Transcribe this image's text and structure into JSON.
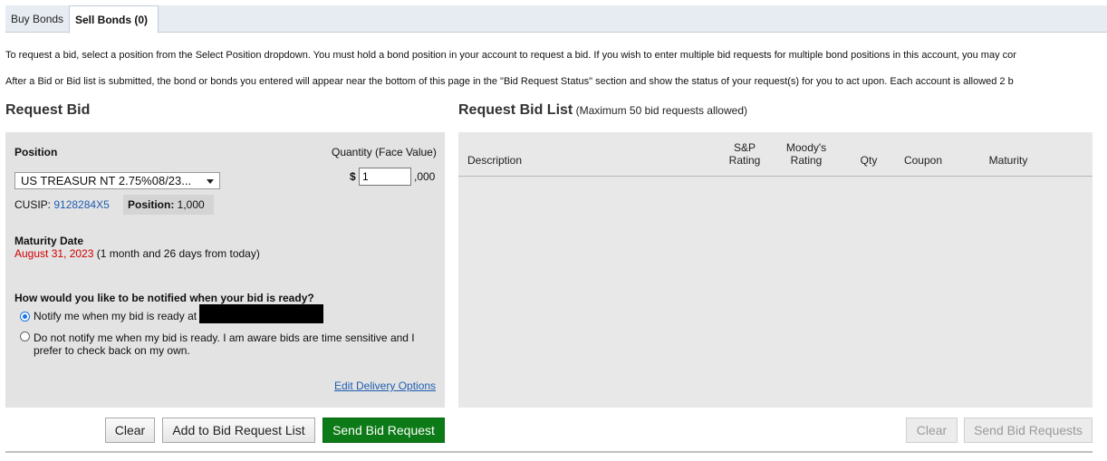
{
  "tabs": [
    {
      "label": "Buy Bonds",
      "active": false
    },
    {
      "label": "Sell Bonds (0)",
      "active": true
    }
  ],
  "intro": {
    "line1": "To request a bid, select a position from the Select Position dropdown. You must hold a bond position in your account to request a bid. If you wish to enter multiple bid requests for multiple bond positions in this account, you may cor",
    "line2": "After a Bid or Bid list is submitted, the bond or bonds you entered will appear near the bottom of this page in the \"Bid Request Status\" section and show the status of your request(s) for you to act upon.  Each account is allowed 2 b"
  },
  "request_bid": {
    "title": "Request Bid",
    "position_label": "Position",
    "quantity_label": "Quantity (Face Value)",
    "position_value": "US TREASUR NT 2.75%08/23...",
    "dollar": "$",
    "quantity_value": "1",
    "quantity_suffix": ",000",
    "cusip_label": "CUSIP:",
    "cusip_value": "9128284X5",
    "position_chip_label": "Position:",
    "position_chip_value": "1,000",
    "maturity_label": "Maturity Date",
    "maturity_date": "August 31, 2023",
    "maturity_relative": "(1 month and 26 days from today)",
    "notify_question": "How would you like to be notified when your bid is ready?",
    "notify_option1": "Notify me when my bid is ready at",
    "notify_option2_line1": "Do not notify me when my bid is ready. I am aware bids are time sensitive and I",
    "notify_option2_line2": "prefer to check back on my own.",
    "edit_delivery": "Edit Delivery Options",
    "btn_clear": "Clear",
    "btn_add": "Add to Bid Request List",
    "btn_send": "Send Bid Request"
  },
  "bid_list": {
    "title": "Request Bid List",
    "note": "(Maximum 50 bid requests allowed)",
    "col_description": "Description",
    "col_sp_line1": "S&P",
    "col_sp_line2": "Rating",
    "col_moodys_line1": "Moody's",
    "col_moodys_line2": "Rating",
    "col_qty": "Qty",
    "col_coupon": "Coupon",
    "col_maturity": "Maturity",
    "btn_clear": "Clear",
    "btn_send": "Send Bid Requests"
  },
  "colors": {
    "primary_button": "#0c7a16",
    "link": "#1f5db1",
    "maturity_red": "#d00000",
    "radio_selected": "#1a73e8"
  }
}
